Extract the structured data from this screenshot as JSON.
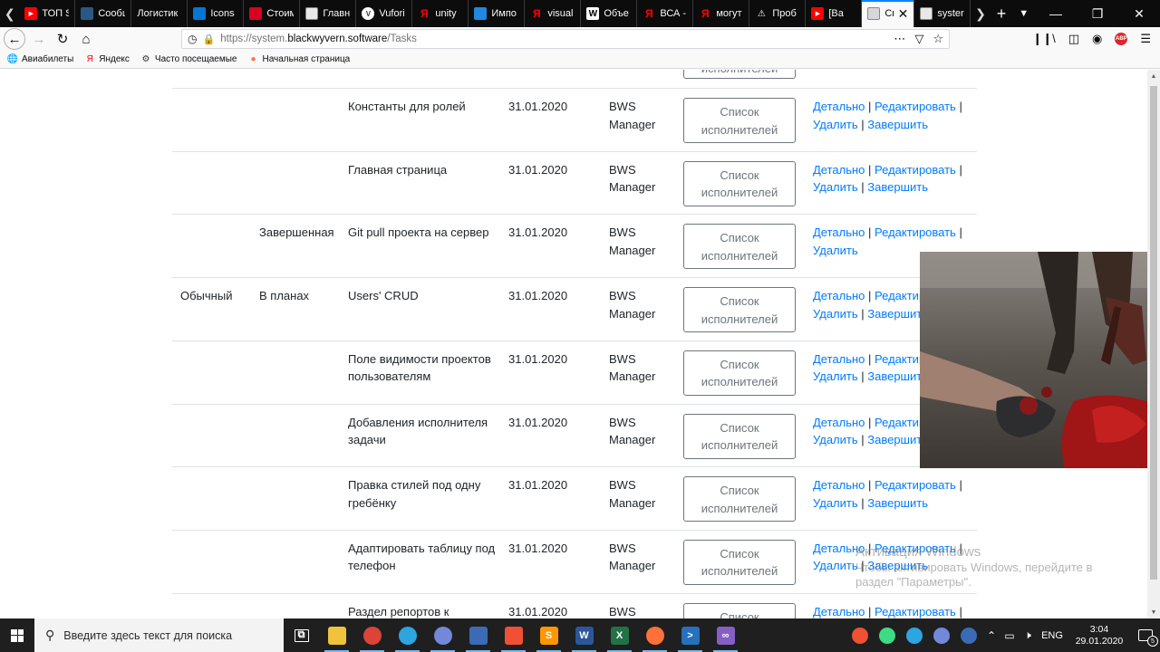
{
  "browser": {
    "tabs": [
      {
        "label": "ТОП S",
        "icon": "youtube-icon",
        "color": "#ff0000"
      },
      {
        "label": "Сообщ",
        "icon": "chat-icon",
        "color": "#2a5885"
      },
      {
        "label": "Логистик",
        "icon": "none",
        "color": "#0c0c0d"
      },
      {
        "label": "Icons",
        "icon": "flag-icon",
        "color": "#0078d7"
      },
      {
        "label": "Стоим",
        "icon": "square-icon",
        "color": "#d70022"
      },
      {
        "label": "Главн",
        "icon": "doc-icon",
        "color": "#5a5a5a"
      },
      {
        "label": "Vufori",
        "icon": "gear-icon",
        "color": "#555"
      },
      {
        "label": "unity",
        "icon": "yandex-icon",
        "color": "#ff0000"
      },
      {
        "label": "Импо",
        "icon": "star-icon",
        "color": "#1e88e5"
      },
      {
        "label": "visual",
        "icon": "yandex-icon",
        "color": "#ff0000"
      },
      {
        "label": "Объе",
        "icon": "wikipedia-icon",
        "color": "#ffffff"
      },
      {
        "label": "ВСА -",
        "icon": "yandex-icon",
        "color": "#ff0000"
      },
      {
        "label": "могут",
        "icon": "yandex-icon",
        "color": "#ff0000"
      },
      {
        "label": "Проб",
        "icon": "warning-icon",
        "color": "#ffffff"
      },
      {
        "label": "[Ва",
        "icon": "youtube-icon",
        "color": "#ff0000"
      },
      {
        "label": "Сп",
        "icon": "doc-icon",
        "color": "#5a5a5a",
        "active": true
      },
      {
        "label": "syster",
        "icon": "doc-icon",
        "color": "#5a5a5a"
      }
    ],
    "url_prefix": "https://system.",
    "url_host": "blackwyvern.software",
    "url_path": "/Tasks",
    "bookmarks": [
      {
        "label": "Авиабилеты",
        "icon": "globe-icon"
      },
      {
        "label": "Яндекс",
        "icon": "yandex-icon"
      },
      {
        "label": "Часто посещаемые",
        "icon": "gear-icon"
      },
      {
        "label": "Начальная страница",
        "icon": "firefox-icon"
      }
    ]
  },
  "table": {
    "partial_top_button": "исполнителей",
    "rows": [
      {
        "type": "",
        "status": "",
        "name": "Константы для ролей",
        "date": "31.01.2020",
        "author": "BWS Manager",
        "button": "Список исполнителей",
        "actions": [
          "Детально",
          "Редактировать",
          "Удалить",
          "Завершить"
        ]
      },
      {
        "type": "",
        "status": "",
        "name": "Главная страница",
        "date": "31.01.2020",
        "author": "BWS Manager",
        "button": "Список исполнителей",
        "actions": [
          "Детально",
          "Редактировать",
          "Удалить",
          "Завершить"
        ]
      },
      {
        "type": "",
        "status": "Завершенная",
        "name": "Git pull проекта на сервер",
        "date": "31.01.2020",
        "author": "BWS Manager",
        "button": "Список исполнителей",
        "actions": [
          "Детально",
          "Редактировать",
          "Удалить"
        ]
      },
      {
        "type": "Обычный",
        "status": "В планах",
        "name": "Users' CRUD",
        "date": "31.01.2020",
        "author": "BWS Manager",
        "button": "Список исполнителей",
        "actions": [
          "Детально",
          "Редактировать",
          "Удалить",
          "Завершить"
        ]
      },
      {
        "type": "",
        "status": "",
        "name": "Поле видимости проектов пользователям",
        "date": "31.01.2020",
        "author": "BWS Manager",
        "button": "Список исполнителей",
        "actions": [
          "Детально",
          "Редактировать",
          "Удалить",
          "Завершить"
        ]
      },
      {
        "type": "",
        "status": "",
        "name": "Добавления исполнителя задачи",
        "date": "31.01.2020",
        "author": "BWS Manager",
        "button": "Список исполнителей",
        "actions": [
          "Детально",
          "Редактировать",
          "Удалить",
          "Завершить"
        ]
      },
      {
        "type": "",
        "status": "",
        "name": "Правка стилей под одну гребёнку",
        "date": "31.01.2020",
        "author": "BWS Manager",
        "button": "Список исполнителей",
        "actions": [
          "Детально",
          "Редактировать",
          "Удалить",
          "Завершить"
        ]
      },
      {
        "type": "",
        "status": "",
        "name": "Адаптировать таблицу под телефон",
        "date": "31.01.2020",
        "author": "BWS Manager",
        "button": "Список исполнителей",
        "actions": [
          "Детально",
          "Редактировать",
          "Удалить",
          "Завершить"
        ]
      },
      {
        "type": "",
        "status": "",
        "name": "Раздел репортов к",
        "date": "31.01.2020",
        "author": "BWS",
        "button": "Список",
        "actions": [
          "Детально",
          "Редактировать"
        ]
      }
    ]
  },
  "watermark": {
    "title": "Активация Windows",
    "text": "Чтобы активировать Windows, перейдите в раздел \"Параметры\"."
  },
  "taskbar": {
    "search_placeholder": "Введите здесь текст для поиска",
    "apps": [
      {
        "name": "task-view-icon",
        "color": "#1f1f1f",
        "glyph": "⧉"
      },
      {
        "name": "file-explorer-icon",
        "color": "#f0c33c",
        "glyph": ""
      },
      {
        "name": "chrome-icon",
        "color": "#db4437",
        "glyph": ""
      },
      {
        "name": "telegram-ext-icon",
        "color": "#2ca5e0",
        "glyph": ""
      },
      {
        "name": "discord-icon",
        "color": "#7289da",
        "glyph": ""
      },
      {
        "name": "network-app-icon",
        "color": "#3b6bb5",
        "glyph": ""
      },
      {
        "name": "git-icon",
        "color": "#f05033",
        "glyph": ""
      },
      {
        "name": "sublime-icon",
        "color": "#ff9800",
        "glyph": "S"
      },
      {
        "name": "word-icon",
        "color": "#2b579a",
        "glyph": "W"
      },
      {
        "name": "excel-icon",
        "color": "#217346",
        "glyph": "X"
      },
      {
        "name": "firefox-icon",
        "color": "#ff7139",
        "glyph": ""
      },
      {
        "name": "powershell-icon",
        "color": "#2671be",
        "glyph": ">"
      },
      {
        "name": "visual-studio-icon",
        "color": "#865fc5",
        "glyph": "∞"
      }
    ],
    "tray_apps": [
      {
        "name": "git-tray-icon",
        "color": "#f05033"
      },
      {
        "name": "android-tray-icon",
        "color": "#3ddc84"
      },
      {
        "name": "telegram-tray-icon",
        "color": "#2ca5e0"
      },
      {
        "name": "discord-tray-icon",
        "color": "#7289da"
      },
      {
        "name": "network-tray-icon",
        "color": "#3b6bb5"
      }
    ],
    "language": "ENG",
    "time": "3:04",
    "date": "29.01.2020",
    "notifications": "5"
  },
  "colors": {
    "link": "#007bff",
    "button_border": "#6c757d",
    "row_border": "#dee2e6",
    "tab_strip": "#0c0c0d",
    "active_tab_accent": "#0a84ff",
    "taskbar": "#1f1f1f"
  }
}
